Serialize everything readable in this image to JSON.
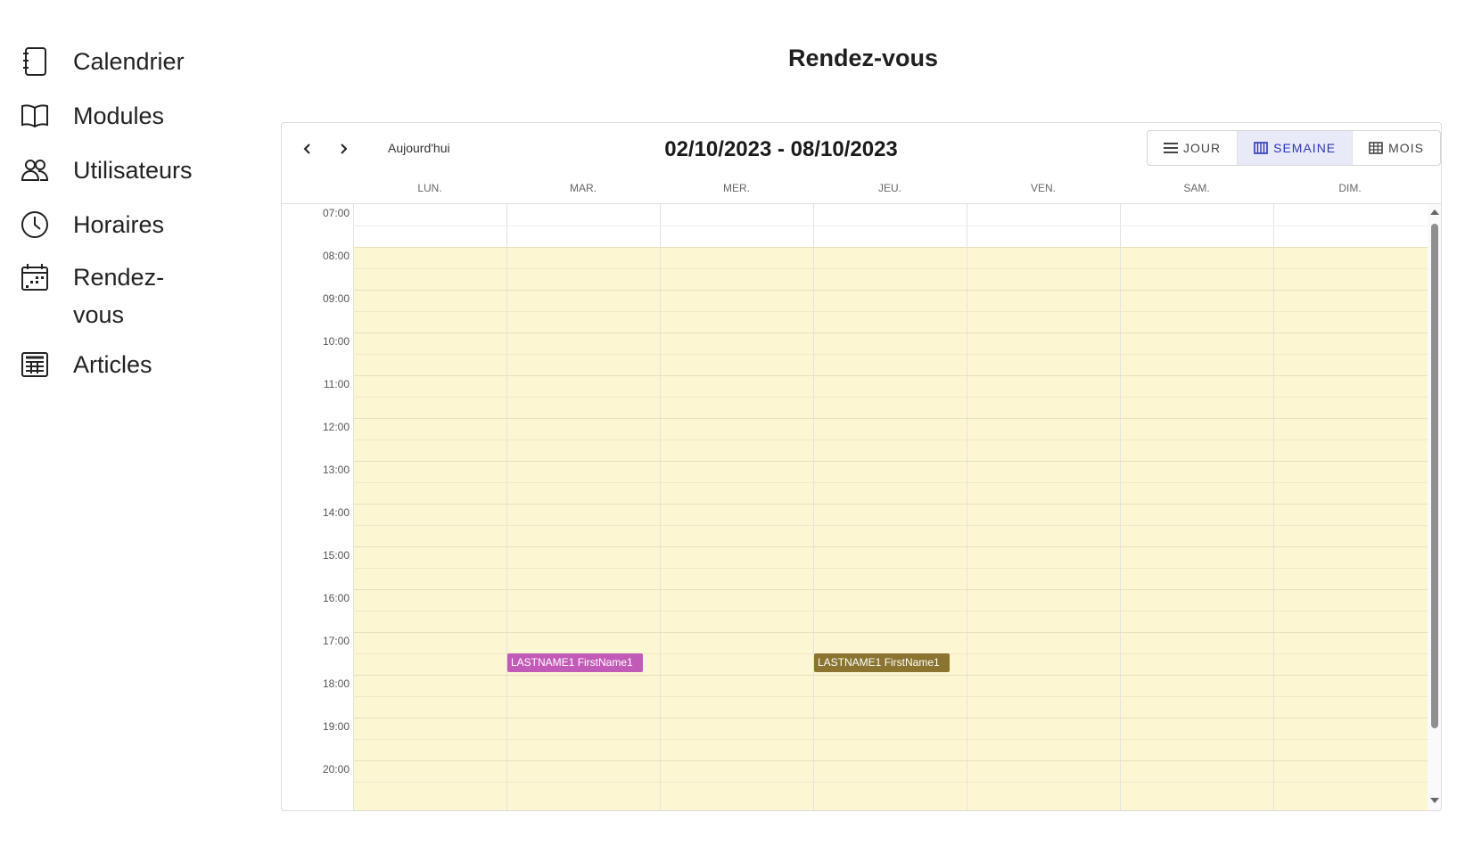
{
  "sidebar": {
    "items": [
      {
        "label": "Calendrier",
        "icon": "calendar-book-icon"
      },
      {
        "label": "Modules",
        "icon": "book-open-icon"
      },
      {
        "label": "Utilisateurs",
        "icon": "users-icon"
      },
      {
        "label": "Horaires",
        "icon": "clock-icon"
      },
      {
        "label": "Rendez-vous",
        "icon": "calendar-dots-icon"
      },
      {
        "label": "Articles",
        "icon": "newspaper-icon"
      }
    ]
  },
  "page": {
    "title": "Rendez-vous"
  },
  "calendar": {
    "today_label": "Aujourd'hui",
    "range": "02/10/2023 - 08/10/2023",
    "views": [
      {
        "label": "JOUR",
        "icon": "list-icon",
        "active": false
      },
      {
        "label": "SEMAINE",
        "icon": "week-columns-icon",
        "active": true
      },
      {
        "label": "MOIS",
        "icon": "month-grid-icon",
        "active": false
      }
    ],
    "days": [
      "LUN.",
      "MAR.",
      "MER.",
      "JEU.",
      "VEN.",
      "SAM.",
      "DIM."
    ],
    "hours": [
      "07:00",
      "08:00",
      "09:00",
      "10:00",
      "11:00",
      "12:00",
      "13:00",
      "14:00",
      "15:00",
      "16:00",
      "17:00",
      "18:00",
      "19:00",
      "20:00"
    ],
    "working_hours_start": "08:00",
    "events": [
      {
        "title": "LASTNAME1 FirstName1",
        "day": "MAR.",
        "start": "17:30",
        "end": "18:00",
        "color": "#c25bb8"
      },
      {
        "title": "LASTNAME1 FirstName1",
        "day": "JEU.",
        "start": "17:30",
        "end": "18:00",
        "color": "#8a7430"
      }
    ],
    "colors": {
      "working_hours_bg": "#fdf6d2",
      "active_view": "#2b36b6"
    }
  }
}
